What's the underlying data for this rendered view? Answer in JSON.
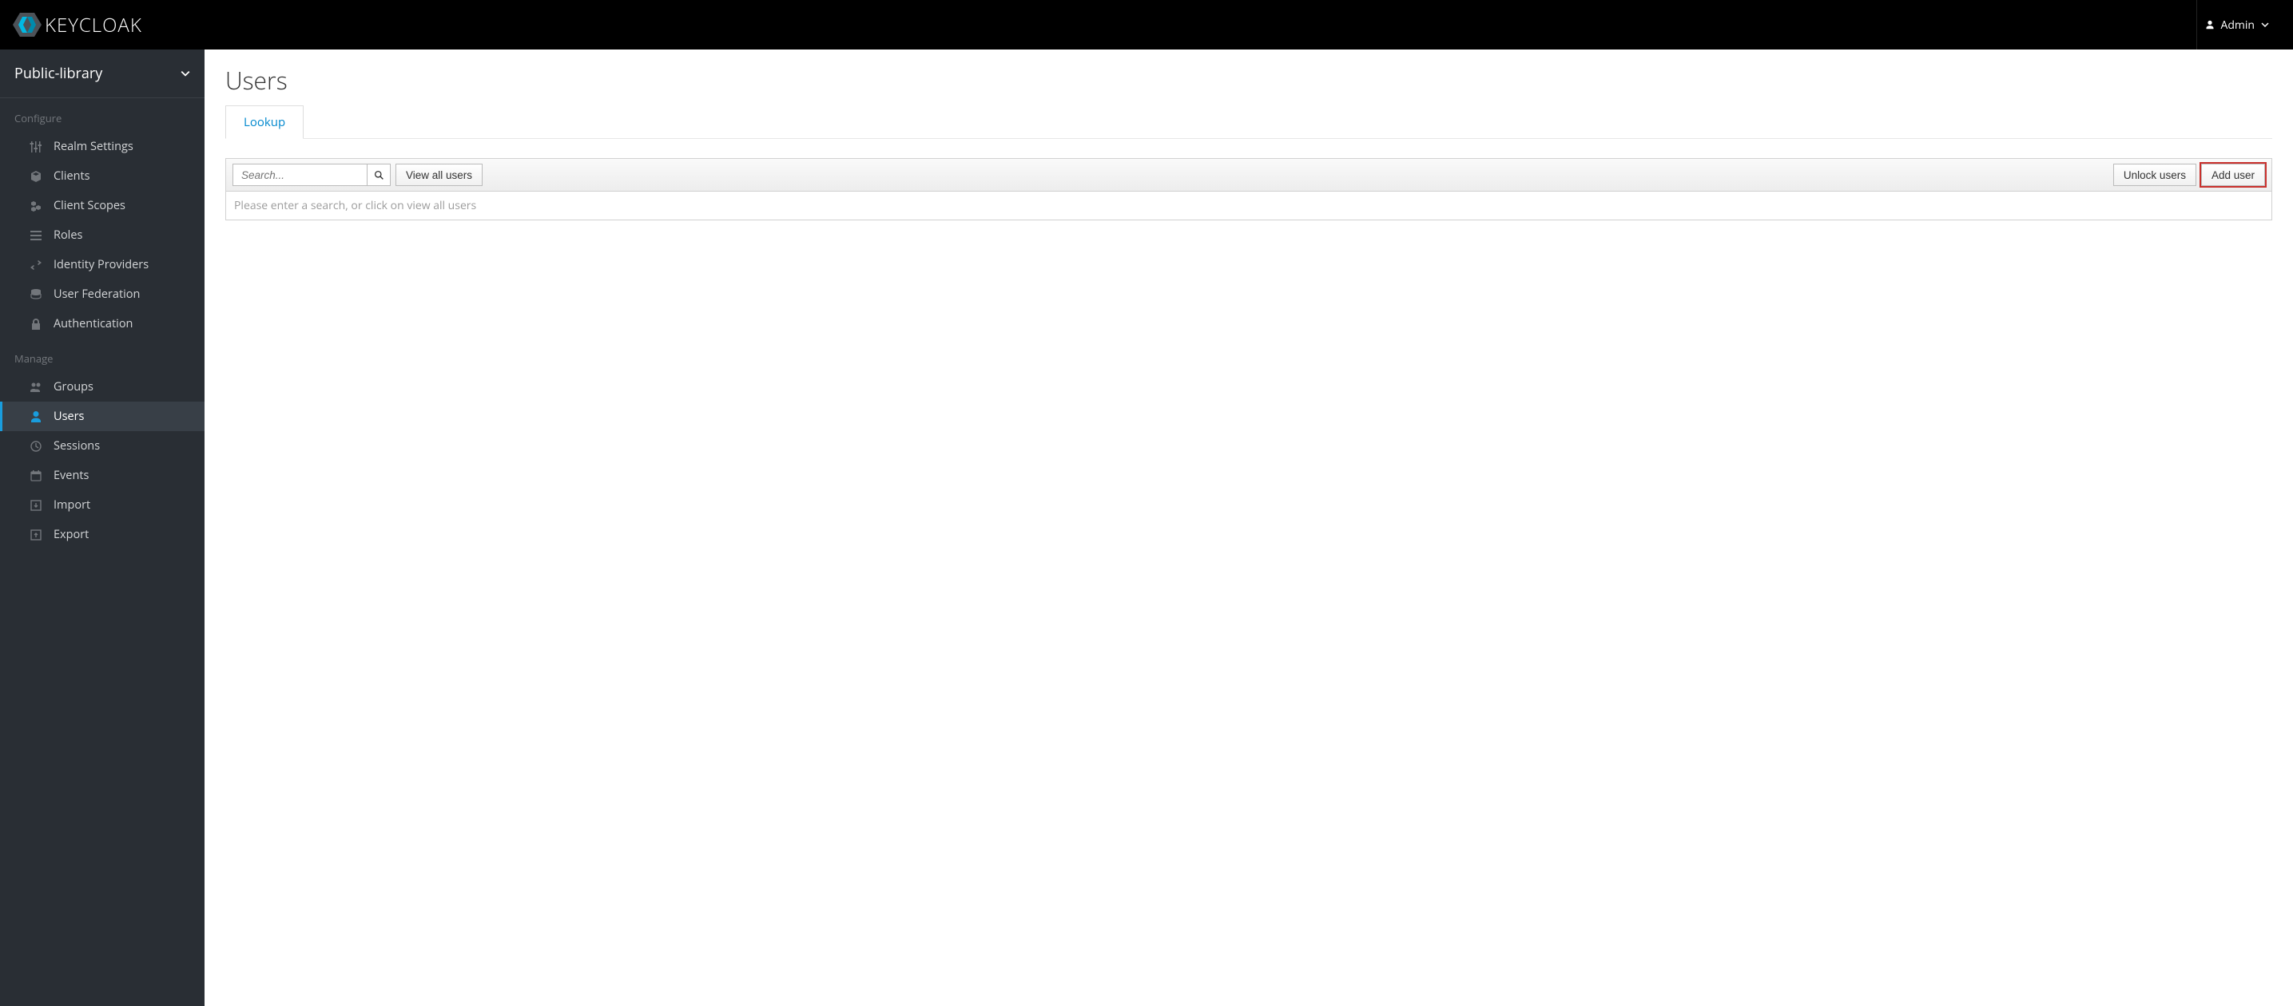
{
  "header": {
    "brand": "KEYCLOAK",
    "user_label": "Admin"
  },
  "sidebar": {
    "realm": "Public-library",
    "sections": {
      "configure_label": "Configure",
      "manage_label": "Manage"
    },
    "configure_items": [
      {
        "label": "Realm Settings"
      },
      {
        "label": "Clients"
      },
      {
        "label": "Client Scopes"
      },
      {
        "label": "Roles"
      },
      {
        "label": "Identity Providers"
      },
      {
        "label": "User Federation"
      },
      {
        "label": "Authentication"
      }
    ],
    "manage_items": [
      {
        "label": "Groups"
      },
      {
        "label": "Users"
      },
      {
        "label": "Sessions"
      },
      {
        "label": "Events"
      },
      {
        "label": "Import"
      },
      {
        "label": "Export"
      }
    ]
  },
  "main": {
    "title": "Users",
    "tab_lookup": "Lookup",
    "search_placeholder": "Search...",
    "view_all_label": "View all users",
    "unlock_label": "Unlock users",
    "add_user_label": "Add user",
    "hint": "Please enter a search, or click on view all users"
  }
}
